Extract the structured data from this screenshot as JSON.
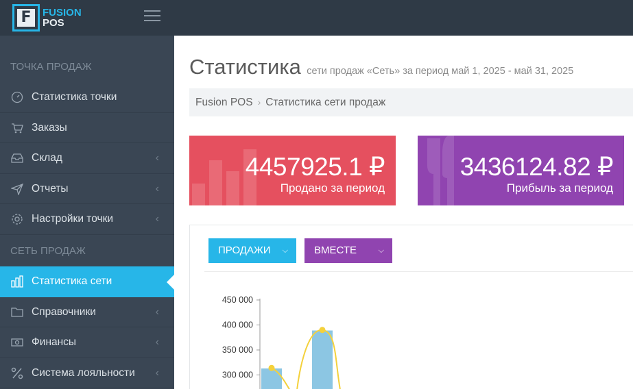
{
  "app": {
    "logo_letter": "F",
    "logo_line1": "FUSION",
    "logo_line2": "POS"
  },
  "sidebar": {
    "section1": "ТОЧКА ПРОДАЖ",
    "section2": "СЕТЬ ПРОДАЖ",
    "items": [
      {
        "label": "Статистика точки",
        "icon": "speedometer-icon"
      },
      {
        "label": "Заказы",
        "icon": "cart-icon"
      },
      {
        "label": "Склад",
        "icon": "inbox-icon"
      },
      {
        "label": "Отчеты",
        "icon": "paper-plane-icon"
      },
      {
        "label": "Настройки точки",
        "icon": "gear-icon"
      },
      {
        "label": "Статистика сети",
        "icon": "bar-chart-icon"
      },
      {
        "label": "Справочники",
        "icon": "folder-icon"
      },
      {
        "label": "Финансы",
        "icon": "money-icon"
      },
      {
        "label": "Система лояльности",
        "icon": "percent-icon"
      }
    ]
  },
  "header": {
    "title": "Статистика",
    "subtitle": "сети продаж «Сеть» за период май 1, 2025 - май 31, 2025"
  },
  "breadcrumb": {
    "root": "Fusion POS",
    "current": "Статистика сети продаж"
  },
  "stats": {
    "sold_value": "4457925.1 ₽",
    "sold_label": "Продано за период",
    "profit_value": "3436124.82 ₽",
    "profit_label": "Прибыль за период"
  },
  "filters": {
    "sales_label": "ПРОДАЖИ",
    "mode_label": "ВМЕСТЕ"
  },
  "colors": {
    "accent": "#27b6e8",
    "red": "#e5505f",
    "purple": "#9044b0",
    "sidebar": "#3a4654",
    "topbar": "#2f3a46"
  },
  "chart_data": {
    "type": "bar",
    "y_ticks": [
      "450 000",
      "400 000",
      "350 000",
      "300 000"
    ],
    "categories": [
      "",
      ""
    ],
    "series": [
      {
        "type": "bar",
        "values": [
          313000,
          389000
        ]
      },
      {
        "type": "line",
        "values": [
          314000,
          390000
        ]
      }
    ],
    "ylim": [
      290000,
      450000
    ]
  }
}
